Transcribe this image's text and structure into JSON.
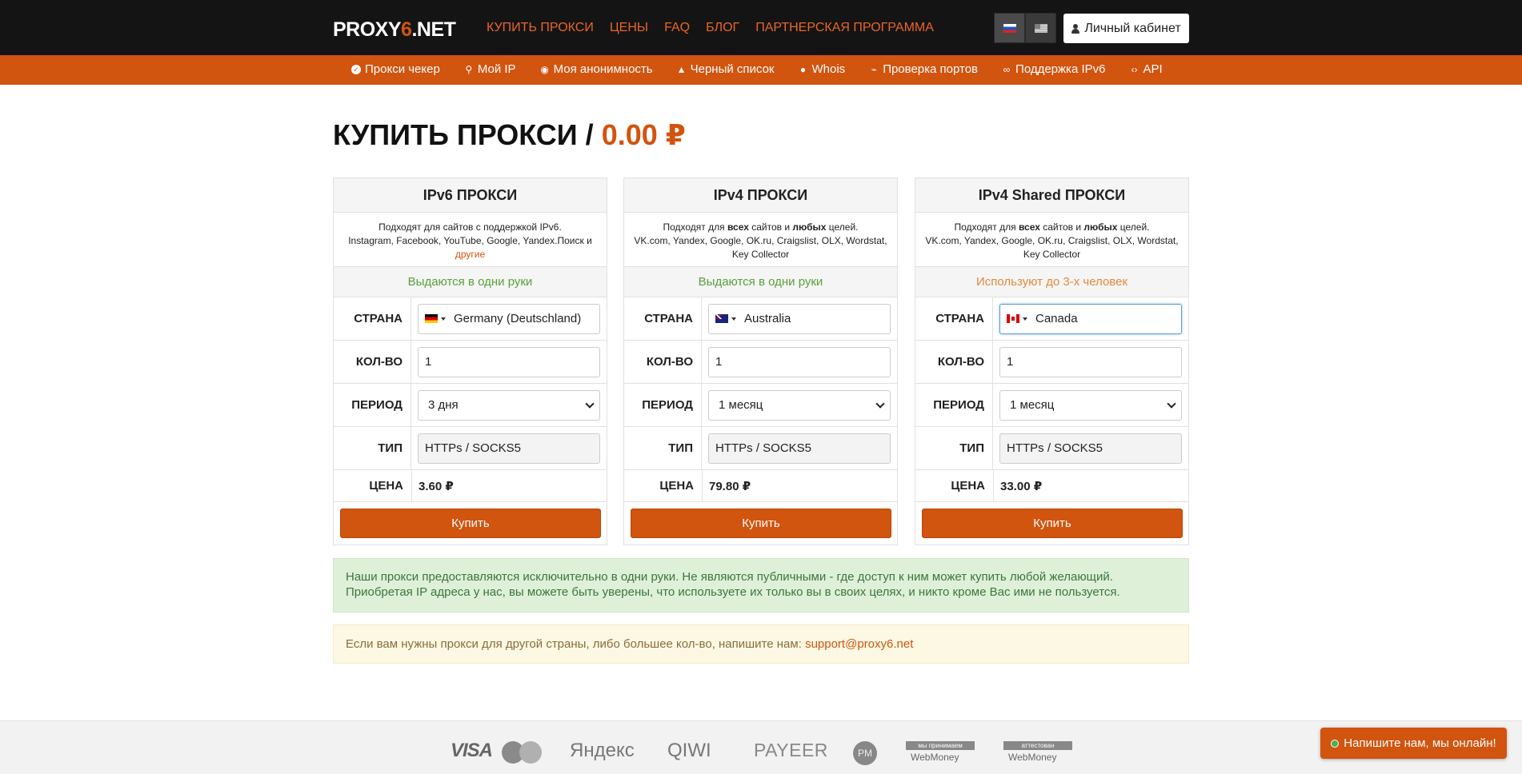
{
  "header": {
    "logo_a": "PROXY",
    "logo_b": "6",
    "logo_c": ".NET",
    "nav": [
      "КУПИТЬ ПРОКСИ",
      "ЦЕНЫ",
      "FAQ",
      "БЛОГ",
      "ПАРТНЕРСКАЯ ПРОГРАММА"
    ],
    "cabinet_label": "Личный кабинет",
    "languages": [
      "ru",
      "en"
    ],
    "active_language": "ru"
  },
  "subnav": [
    {
      "label": "Прокси чекер",
      "icon": "check-circle-icon"
    },
    {
      "label": "Мой IP",
      "icon": "map-marker-icon"
    },
    {
      "label": "Моя анонимность",
      "icon": "eye-icon"
    },
    {
      "label": "Черный список",
      "icon": "warning-icon"
    },
    {
      "label": "Whois",
      "icon": "globe-icon"
    },
    {
      "label": "Проверка портов",
      "icon": "plug-icon"
    },
    {
      "label": "Поддержка IPv6",
      "icon": "link-icon"
    },
    {
      "label": "API",
      "icon": "code-icon"
    }
  ],
  "page": {
    "title": "КУПИТЬ ПРОКСИ",
    "separator": " / ",
    "total": "0.00 ₽"
  },
  "labels": {
    "country": "СТРАНА",
    "qty": "КОЛ-ВО",
    "period": "ПЕРИОД",
    "type": "ТИП",
    "price": "ЦЕНА",
    "buy": "Купить"
  },
  "cards": [
    {
      "title": "IPv6 ПРОКСИ",
      "desc_line1": "Подходят для сайтов с поддержкой IPv6.",
      "desc_line2": "Instagram, Facebook, YouTube, Google, Yandex.Поиск и",
      "desc_link": "другие",
      "note": "Выдаются в одни руки",
      "country": "Germany (Deutschland)",
      "country_flag": "de",
      "qty": "1",
      "period": "3 дня",
      "type": "HTTPs / SOCKS5",
      "price": "3.60 ₽"
    },
    {
      "title": "IPv4 ПРОКСИ",
      "desc_pre": "Подходят для ",
      "desc_b1": "всех",
      "desc_mid": " сайтов и ",
      "desc_b2": "любых",
      "desc_post": " целей.",
      "desc_line2": "VK.com, Yandex, Google, OK.ru, Craigslist, OLX, Wordstat, Key Collector",
      "note": "Выдаются в одни руки",
      "country": "Australia",
      "country_flag": "au",
      "qty": "1",
      "period": "1 месяц",
      "type": "HTTPs / SOCKS5",
      "price": "79.80 ₽"
    },
    {
      "title": "IPv4 Shared ПРОКСИ",
      "desc_pre": "Подходят для ",
      "desc_b1": "всех",
      "desc_mid": " сайтов и ",
      "desc_b2": "любых",
      "desc_post": " целей.",
      "desc_line2": "VK.com, Yandex, Google, OK.ru, Craigslist, OLX, Wordstat, Key Collector",
      "note": "Используют до 3-х человек",
      "country": "Canada",
      "country_flag": "ca",
      "qty": "1",
      "period": "1 месяц",
      "type": "HTTPs / SOCKS5",
      "price": "33.00 ₽"
    }
  ],
  "alerts": {
    "green_line1": "Наши прокси предоставляются исключительно в одни руки. Не являются публичными - где доступ к ним может купить любой желающий.",
    "green_line2": "Приобретая IP адреса у нас, вы можете быть уверены, что используете их только вы в своих целях, и никто кроме Вас ими не пользуется.",
    "yellow_text": "Если вам нужны прокси для другой страны, либо большее кол-во, напишите нам: ",
    "yellow_email": "support@proxy6.net"
  },
  "footer": {
    "visa": "VISA",
    "mastercard": "MasterCard",
    "yandex": "Яндекс",
    "qiwi": "QIWI",
    "payeer": "PAYEER",
    "pm": "PM",
    "wm1_top": "мы принимаем",
    "wm1_bottom": "WebMoney",
    "wm2_top": "аттестован",
    "wm2_bottom": "WebMoney"
  },
  "chat": {
    "label": "Напишите нам, мы онлайн!"
  },
  "colors": {
    "accent": "#d1540f",
    "header_bg": "#141414",
    "success_text": "#3c763d",
    "warning_text": "#8a6d3b"
  }
}
